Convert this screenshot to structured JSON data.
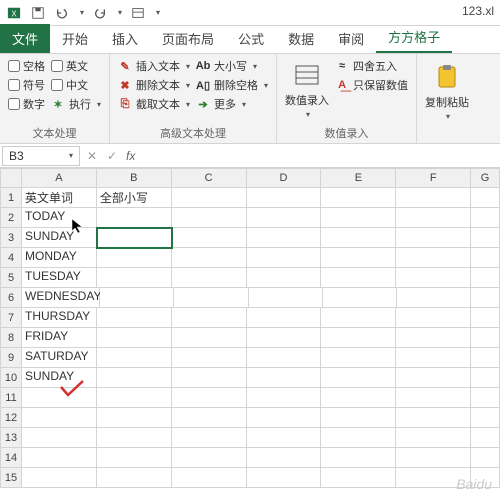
{
  "title": "123.xl",
  "tabs": {
    "file": "文件",
    "home": "开始",
    "insert": "插入",
    "layout": "页面布局",
    "formulas": "公式",
    "data": "数据",
    "review": "审阅",
    "addon": "方方格子"
  },
  "ribbon": {
    "g1": {
      "space": "空格",
      "english": "英文",
      "symbol": "符号",
      "chinese": "中文",
      "number": "数字",
      "execute": "执行",
      "label": "文本处理"
    },
    "g2": {
      "insertText": "插入文本",
      "deleteText": "删除文本",
      "extractText": "截取文本",
      "case": "大小写",
      "deleteSpace": "删除空格",
      "more": "更多",
      "label": "高级文本处理"
    },
    "g3": {
      "numEntry": "数值录入",
      "round": "四舍五入",
      "keepNum": "只保留数值",
      "label": "数值录入"
    },
    "g4": {
      "copyPaste": "复制粘贴"
    }
  },
  "nameBox": "B3",
  "colHeaders": [
    "A",
    "B",
    "C",
    "D",
    "E",
    "F",
    "G"
  ],
  "rows": [
    {
      "n": "1",
      "a": "英文单词",
      "b": "全部小写"
    },
    {
      "n": "2",
      "a": "TODAY",
      "b": ""
    },
    {
      "n": "3",
      "a": "SUNDAY",
      "b": ""
    },
    {
      "n": "4",
      "a": "MONDAY",
      "b": ""
    },
    {
      "n": "5",
      "a": "TUESDAY",
      "b": ""
    },
    {
      "n": "6",
      "a": "WEDNESDAY",
      "b": ""
    },
    {
      "n": "7",
      "a": "THURSDAY",
      "b": ""
    },
    {
      "n": "8",
      "a": "FRIDAY",
      "b": ""
    },
    {
      "n": "9",
      "a": "SATURDAY",
      "b": ""
    },
    {
      "n": "10",
      "a": "SUNDAY",
      "b": ""
    },
    {
      "n": "11",
      "a": "",
      "b": ""
    },
    {
      "n": "12",
      "a": "",
      "b": ""
    },
    {
      "n": "13",
      "a": "",
      "b": ""
    },
    {
      "n": "14",
      "a": "",
      "b": ""
    },
    {
      "n": "15",
      "a": "",
      "b": ""
    }
  ],
  "selected": {
    "row": 3,
    "col": "B"
  },
  "watermark": "Baidu"
}
